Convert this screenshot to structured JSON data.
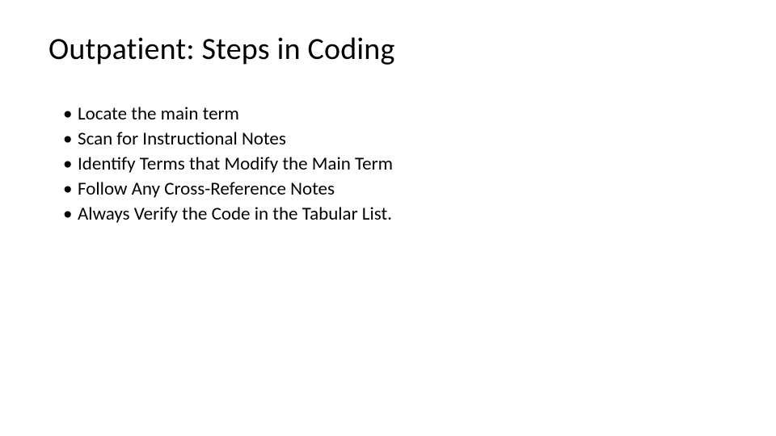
{
  "slide": {
    "title": "Outpatient:  Steps in Coding",
    "bullets": [
      "Locate the main term",
      "Scan for Instructional Notes",
      "Identify Terms that Modify the Main Term",
      "Follow Any Cross-Reference Notes",
      "Always Verify the Code in the Tabular List."
    ]
  }
}
